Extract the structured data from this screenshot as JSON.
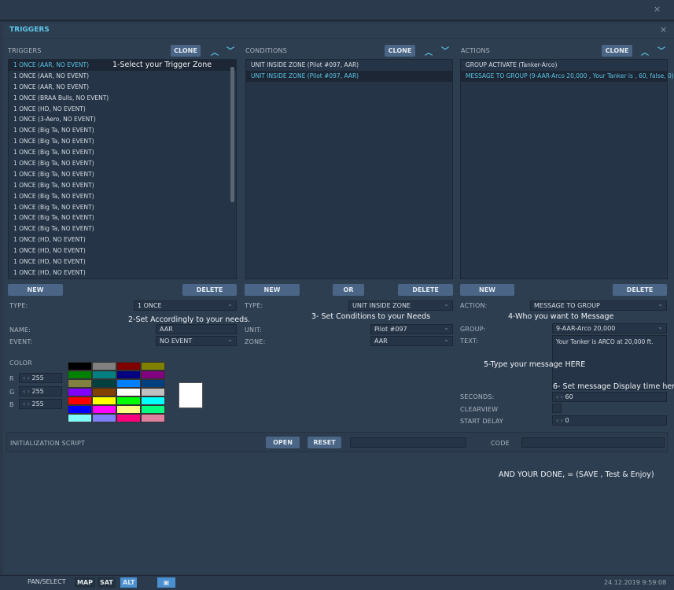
{
  "window": {
    "title": "TRIGGERS",
    "close": "×"
  },
  "triggers": {
    "header": "TRIGGERS",
    "clone": "CLONE",
    "up": "⌃",
    "down": "⌄",
    "items": [
      "1 ONCE (AAR, NO EVENT)",
      "1 ONCE (AAR, NO EVENT)",
      "1 ONCE (AAR, NO EVENT)",
      "1 ONCE (BRAA Bulls, NO EVENT)",
      "1 ONCE (HD, NO EVENT)",
      "1 ONCE (3-Aero, NO EVENT)",
      "1 ONCE (Big Ta, NO EVENT)",
      "1 ONCE (Big Ta, NO EVENT)",
      "1 ONCE (Big Ta, NO EVENT)",
      "1 ONCE (Big Ta, NO EVENT)",
      "1 ONCE (Big Ta, NO EVENT)",
      "1 ONCE (Big Ta, NO EVENT)",
      "1 ONCE (Big Ta, NO EVENT)",
      "1 ONCE (Big Ta, NO EVENT)",
      "1 ONCE (Big Ta, NO EVENT)",
      "1 ONCE (Big Ta, NO EVENT)",
      "1 ONCE (HD, NO EVENT)",
      "1 ONCE (HD, NO EVENT)",
      "1 ONCE (HD, NO EVENT)",
      "1 ONCE (HD, NO EVENT)"
    ],
    "new": "NEW",
    "delete": "DELETE",
    "type_label": "TYPE:",
    "type_value": "1 ONCE",
    "name_label": "NAME:",
    "name_value": "AAR",
    "event_label": "EVENT:",
    "event_value": "NO EVENT",
    "color_label": "COLOR",
    "r_label": "R",
    "g_label": "G",
    "b_label": "B",
    "r": "255",
    "g": "255",
    "b": "255",
    "palette": [
      "#000000",
      "#808080",
      "#800000",
      "#808000",
      "#008000",
      "#008080",
      "#000080",
      "#800080",
      "#808040",
      "#004040",
      "#0080ff",
      "#004080",
      "#8000ff",
      "#804000",
      "#ffffff",
      "#c0c0c0",
      "#ff0000",
      "#ffff00",
      "#00ff00",
      "#00ffff",
      "#0000ff",
      "#ff00ff",
      "#ffff80",
      "#00ff80",
      "#80ffff",
      "#8080ff",
      "#ff0080",
      "#e080a0"
    ],
    "preview_color": "#ffffff"
  },
  "conditions": {
    "header": "CONDITIONS",
    "clone": "CLONE",
    "items": [
      "UNIT INSIDE ZONE (Pilot #097, AAR)",
      "UNIT INSIDE ZONE (Pilot #097, AAR)"
    ],
    "new": "NEW",
    "or": "OR",
    "delete": "DELETE",
    "type_label": "TYPE:",
    "type_value": "UNIT INSIDE ZONE",
    "unit_label": "UNIT:",
    "unit_value": "Pilot #097",
    "zone_label": "ZONE:",
    "zone_value": "AAR"
  },
  "actions": {
    "header": "ACTIONS",
    "clone": "CLONE",
    "items": [
      "GROUP ACTIVATE (Tanker-Arco)",
      "MESSAGE TO GROUP (9-AAR-Arco 20,000 , Your Tanker is , 60, false, 0)"
    ],
    "new": "NEW",
    "delete": "DELETE",
    "action_label": "ACTION:",
    "action_value": "MESSAGE TO GROUP",
    "group_label": "GROUP:",
    "group_value": "9-AAR-Arco 20,000",
    "text_label": "TEXT:",
    "text_value": "Your Tanker is    ARCO   at  20,000 ft.",
    "seconds_label": "SECONDS:",
    "seconds_value": "60",
    "clearview_label": "CLEARVIEW",
    "start_delay_label": "START DELAY",
    "start_delay_value": "0"
  },
  "init": {
    "label": "INITIALIZATION SCRIPT",
    "open": "OPEN",
    "reset": "RESET",
    "code_label": "CODE"
  },
  "notes": {
    "n1": "1-Select your Trigger Zone",
    "n2": "2-Set Accordingly to your needs.",
    "n3": "3- Set Conditions to your Needs",
    "n4": "4-Who you want to Message",
    "n5": "5-Type your message HERE",
    "n6": "6- Set message Display time here",
    "n7": "AND YOUR DONE, = (SAVE , Test & Enjoy)"
  },
  "status": {
    "pan": "PAN/SELECT",
    "map": "MAP",
    "sat": "SAT",
    "alt": "ALT",
    "datetime": "24.12.2019 9:59:08"
  },
  "spinner": "‹ ›"
}
